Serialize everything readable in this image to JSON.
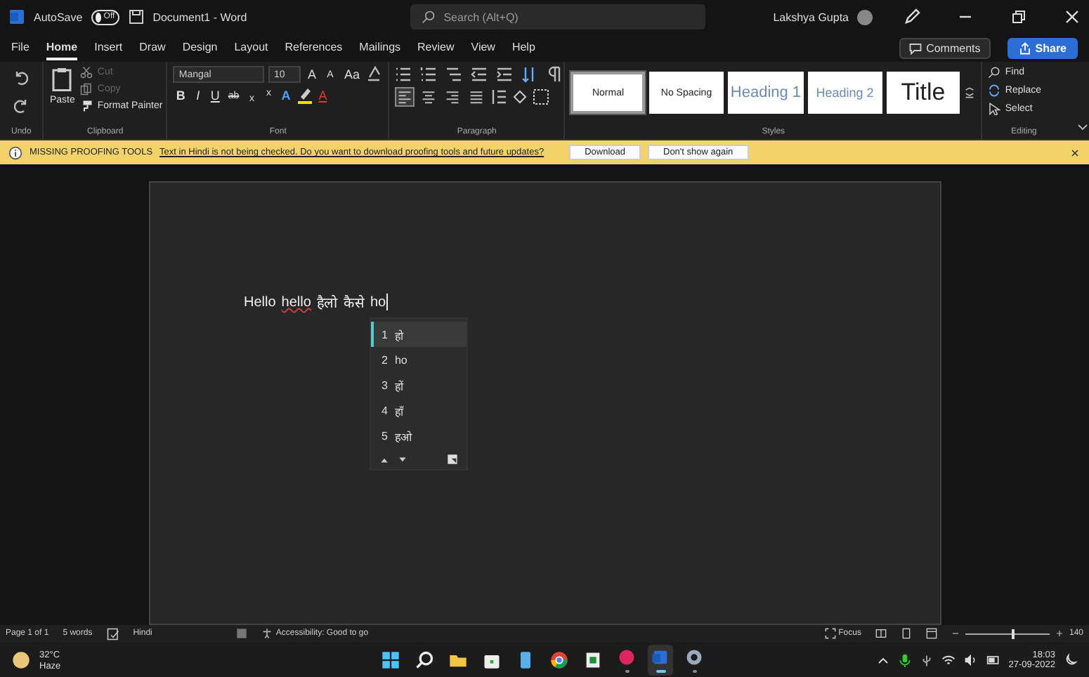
{
  "title_bar": {
    "autosave_label": "AutoSave",
    "autosave": {
      "on": false,
      "label": "Off"
    },
    "document_title": "Document1 - Word",
    "search_placeholder": "Search (Alt+Q)",
    "user_name": "Lakshya Gupta"
  },
  "menu_tabs": [
    {
      "label": "File",
      "selected": false
    },
    {
      "label": "Home",
      "selected": true
    },
    {
      "label": "Insert",
      "selected": false
    },
    {
      "label": "Draw",
      "selected": false
    },
    {
      "label": "Design",
      "selected": false
    },
    {
      "label": "Layout",
      "selected": false
    },
    {
      "label": "References",
      "selected": false
    },
    {
      "label": "Mailings",
      "selected": false
    },
    {
      "label": "Review",
      "selected": false
    },
    {
      "label": "View",
      "selected": false
    },
    {
      "label": "Help",
      "selected": false
    }
  ],
  "comments_button": "Comments",
  "share_button": "Share",
  "ribbon": {
    "undo": {
      "label": "Undo"
    },
    "clipboard": {
      "label": "Clipboard",
      "paste": "Paste",
      "items": [
        {
          "kind": "cut",
          "label": "Cut",
          "disabled": true
        },
        {
          "kind": "copy",
          "label": "Copy",
          "disabled": true
        },
        {
          "kind": "painter",
          "label": "Format Painter",
          "disabled": false
        }
      ]
    },
    "font": {
      "label": "Font",
      "family": "Mangal",
      "size": "10",
      "tools": [
        {
          "kind": "grow",
          "label": "A"
        },
        {
          "kind": "shrink",
          "label": "A"
        },
        {
          "kind": "case",
          "label": "Aa"
        }
      ],
      "format_buttons": [
        {
          "kind": "bold",
          "label": "B"
        },
        {
          "kind": "italic",
          "label": "I"
        },
        {
          "kind": "underline",
          "label": "U"
        },
        {
          "kind": "strike",
          "label": "ab"
        },
        {
          "kind": "sub",
          "label": "x"
        },
        {
          "kind": "super",
          "label": "x"
        },
        {
          "kind": "effects",
          "label": "A"
        },
        {
          "kind": "highlight"
        },
        {
          "kind": "color",
          "label": "A"
        }
      ]
    },
    "paragraph": {
      "label": "Paragraph",
      "alignment": [
        {
          "kind": "left",
          "selected": true
        },
        {
          "kind": "center",
          "selected": false
        },
        {
          "kind": "right",
          "selected": false
        },
        {
          "kind": "justify",
          "selected": false
        }
      ]
    },
    "styles": {
      "label": "Styles",
      "items": [
        {
          "kind": "normal",
          "label": "Normal",
          "selected": true
        },
        {
          "kind": "plain",
          "label": "No Spacing",
          "selected": false
        },
        {
          "kind": "heading",
          "label": "Heading 1",
          "selected": false
        },
        {
          "kind": "heading2",
          "label": "Heading 2",
          "selected": false
        },
        {
          "kind": "title",
          "label": "Title",
          "selected": false
        }
      ]
    },
    "editing": {
      "label": "Editing",
      "items": [
        {
          "kind": "find",
          "label": "Find"
        },
        {
          "kind": "replace",
          "label": "Replace"
        },
        {
          "kind": "select",
          "label": "Select"
        }
      ]
    }
  },
  "message_bar": {
    "title": "MISSING PROOFING TOOLS",
    "message": "Text in Hindi is not being checked. Do you want to download proofing tools and future updates?",
    "buttons": [
      "Download",
      "Don't show again"
    ]
  },
  "document": {
    "words": [
      {
        "text": "Hello",
        "misspelled": false
      },
      {
        "text": "hello",
        "misspelled": true
      },
      {
        "text": "हैलो",
        "misspelled": false
      },
      {
        "text": "कैसे",
        "misspelled": false
      },
      {
        "text": "ho",
        "misspelled": false
      }
    ]
  },
  "suggestions": {
    "items": [
      {
        "number": "1",
        "text": "हो",
        "selected": true
      },
      {
        "number": "2",
        "text": "ho",
        "selected": false
      },
      {
        "number": "3",
        "text": "हों",
        "selected": false
      },
      {
        "number": "4",
        "text": "हाँ",
        "selected": false
      },
      {
        "number": "5",
        "text": "हओ",
        "selected": false
      }
    ]
  },
  "status_bar": {
    "page": "Page 1 of 1",
    "words": "5 words",
    "language": "Hindi",
    "accessibility": "Accessibility: Good to go",
    "focus": "Focus",
    "zoom": {
      "level": 0.55,
      "label": "140"
    }
  },
  "taskbar": {
    "weather": {
      "temperature": "32°C",
      "condition": "Haze"
    },
    "apps": [
      {
        "kind": "start",
        "running": false,
        "selected": false
      },
      {
        "kind": "search",
        "running": false,
        "selected": false
      },
      {
        "kind": "folder",
        "running": false,
        "selected": false
      },
      {
        "kind": "store",
        "running": false,
        "selected": false
      },
      {
        "kind": "notes",
        "running": false,
        "selected": false
      },
      {
        "kind": "browser",
        "running": false,
        "selected": false
      },
      {
        "kind": "sheet",
        "running": false,
        "selected": false
      },
      {
        "kind": "record",
        "running": true,
        "selected": false
      },
      {
        "kind": "word",
        "running": true,
        "selected": true
      },
      {
        "kind": "settings",
        "running": true,
        "selected": false
      }
    ],
    "time": "18:03",
    "date": "27-09-2022"
  }
}
